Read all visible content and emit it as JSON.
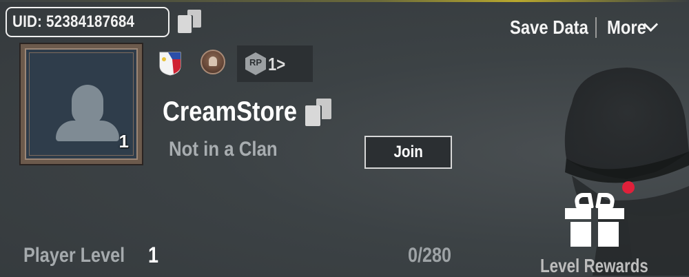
{
  "header": {
    "uid_text": "UID: 52384187684",
    "save_data_label": "Save Data",
    "more_label": "More"
  },
  "profile": {
    "avatar_level": "1",
    "player_name": "CreamStore",
    "clan_status": "Not in a Clan",
    "join_label": "Join",
    "rp_badge_text": "RP",
    "rp_value": "1>"
  },
  "level": {
    "label": "Player Level",
    "value": "1",
    "xp_progress": "0/280"
  },
  "rewards": {
    "label": "Level Rewards",
    "notification_dot_color": "#e0203a"
  },
  "icons": {
    "uid_copy": "copy-icon",
    "name_copy": "copy-icon",
    "more_chevron": "chevron-down-icon",
    "flag": "philippines-flag-icon",
    "tier": "tier-medal-icon",
    "gift": "gift-icon"
  }
}
